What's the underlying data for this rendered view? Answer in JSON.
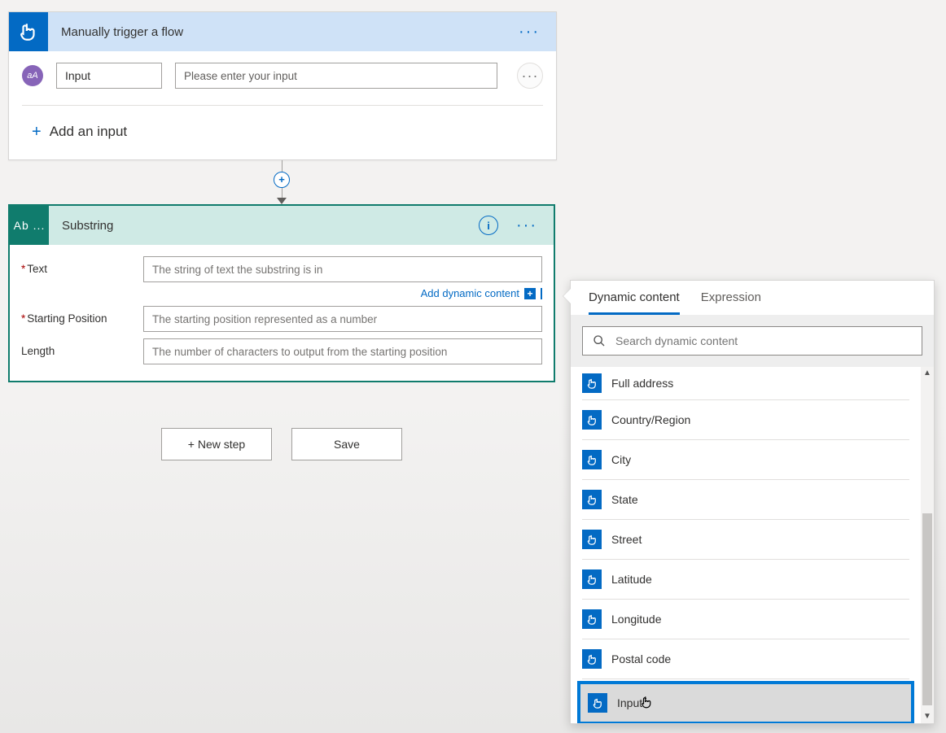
{
  "trigger": {
    "title": "Manually trigger a flow",
    "avatar_initials": "aA",
    "input_name": "Input",
    "input_placeholder": "Please enter your input",
    "add_input_label": "Add an input"
  },
  "action": {
    "icon_text": "Ab ...",
    "title": "Substring",
    "params": {
      "text": {
        "label": "Text",
        "required": true,
        "placeholder": "The string of text the substring is in"
      },
      "start": {
        "label": "Starting Position",
        "required": true,
        "placeholder": "The starting position represented as a number"
      },
      "length": {
        "label": "Length",
        "required": false,
        "placeholder": "The number of characters to output from the starting position"
      }
    },
    "add_dynamic_label": "Add dynamic content"
  },
  "buttons": {
    "new_step": "+ New step",
    "save": "Save"
  },
  "popup": {
    "tabs": {
      "dynamic": "Dynamic content",
      "expression": "Expression"
    },
    "search_placeholder": "Search dynamic content",
    "items": [
      "Full address",
      "Country/Region",
      "City",
      "State",
      "Street",
      "Latitude",
      "Longitude",
      "Postal code",
      "Input"
    ],
    "selected_index": 8
  }
}
